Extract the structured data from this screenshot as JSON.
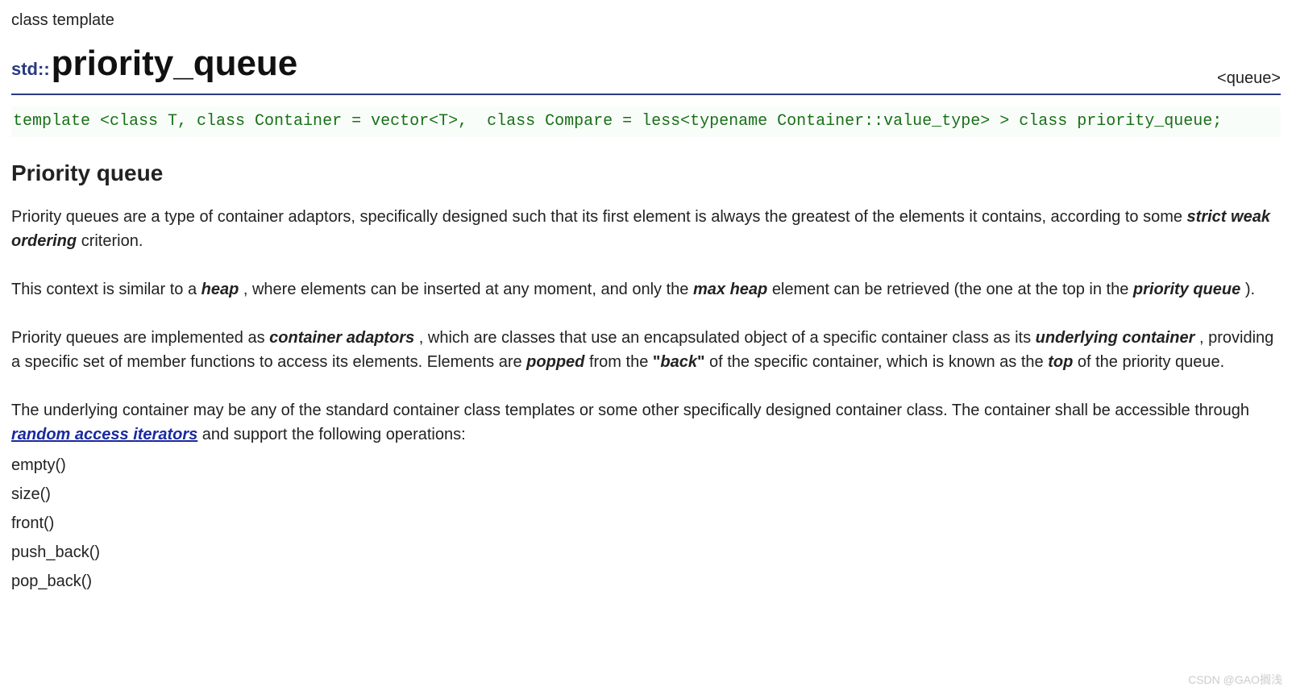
{
  "meta": {
    "class_template_label": "class template"
  },
  "title": {
    "namespace": "std::",
    "name": "priority_queue",
    "header_tag": "<queue>"
  },
  "template_decl": "template <class T, class Container = vector<T>,  class Compare = less<typename Container::value_type> > class priority_queue;",
  "section": {
    "title": "Priority queue"
  },
  "p1": {
    "pre": "Priority queues are a type of container adaptors, specifically designed such that its first element is always the greatest of the elements it contains, according to some ",
    "em1": "strict weak ordering",
    "post": " criterion."
  },
  "p2": {
    "t1": "This context is similar to a ",
    "em1": "heap",
    "t2": ", where elements can be inserted at any moment, and only the ",
    "em2": "max heap",
    "t3": " element can be retrieved (the one at the top in the ",
    "em3": "priority queue",
    "t4": ")."
  },
  "p3": {
    "t1": "Priority queues are implemented as ",
    "em1": "container adaptors",
    "t2": ", which are classes that use an encapsulated object of a specific container class as its ",
    "em2": "underlying container",
    "t3": ", providing a specific set of member functions to access its elements. Elements are ",
    "em3": "popped",
    "t4": " from the ",
    "q1_open": "\"",
    "em4": "back",
    "q1_close": "\"",
    "t5": " of the specific container, which is known as the ",
    "em5": "top",
    "t6": " of the priority queue."
  },
  "p4": {
    "t1": "The underlying container may be any of the standard container class templates or some other specifically designed container class. The container shall be accessible through ",
    "link1": "random access iterators",
    "t2": " and support the following operations:"
  },
  "ops": [
    "empty()",
    "size()",
    "front()",
    "push_back()",
    "pop_back()"
  ],
  "watermark": "CSDN @GAO搁浅"
}
